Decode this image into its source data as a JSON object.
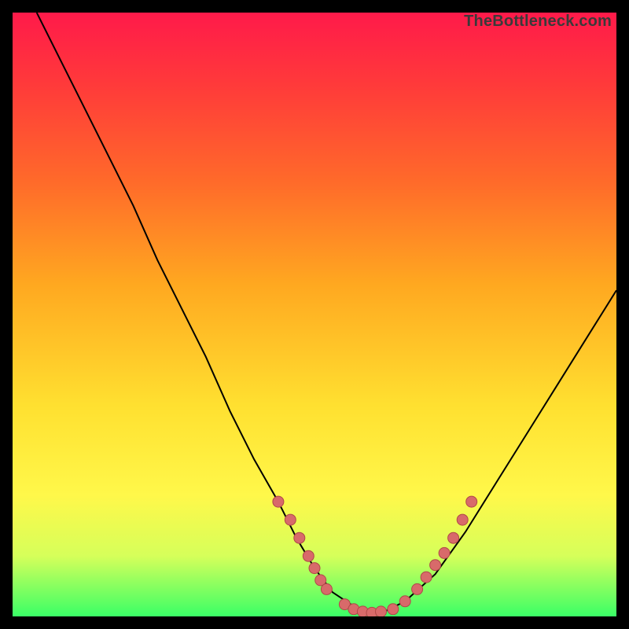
{
  "watermark": {
    "text": "TheBottleneck.com"
  },
  "colors": {
    "frame": "#000000",
    "gradient_top": "#ff1a4a",
    "gradient_bottom": "#3aff66",
    "curve": "#000000",
    "marker_fill": "#d86a6a",
    "marker_stroke": "#b04848"
  },
  "chart_data": {
    "type": "line",
    "title": "",
    "xlabel": "",
    "ylabel": "",
    "xlim": [
      0,
      100
    ],
    "ylim": [
      0,
      100
    ],
    "grid": false,
    "legend": false,
    "series": [
      {
        "name": "bottleneck-curve",
        "x": [
          4,
          8,
          12,
          16,
          20,
          24,
          28,
          32,
          36,
          40,
          44,
          47,
          50,
          53,
          56,
          58,
          60,
          62,
          65,
          70,
          75,
          80,
          85,
          90,
          95,
          100
        ],
        "y": [
          100,
          92,
          84,
          76,
          68,
          59,
          51,
          43,
          34,
          26,
          19,
          13,
          8,
          4,
          2,
          1,
          0.5,
          1,
          2.5,
          7,
          14,
          22,
          30,
          38,
          46,
          54
        ]
      }
    ],
    "markers": [
      {
        "name": "left-cluster",
        "x": [
          44,
          46,
          47.5,
          49,
          50,
          51,
          52
        ],
        "y": [
          19,
          16,
          13,
          10,
          8,
          6,
          4.5
        ]
      },
      {
        "name": "valley-cluster",
        "x": [
          55,
          56.5,
          58,
          59.5,
          61,
          63,
          65
        ],
        "y": [
          2,
          1.2,
          0.8,
          0.6,
          0.8,
          1.2,
          2.5
        ]
      },
      {
        "name": "right-cluster",
        "x": [
          67,
          68.5,
          70,
          71.5,
          73,
          74.5,
          76
        ],
        "y": [
          4.5,
          6.5,
          8.5,
          10.5,
          13,
          16,
          19
        ]
      }
    ]
  }
}
